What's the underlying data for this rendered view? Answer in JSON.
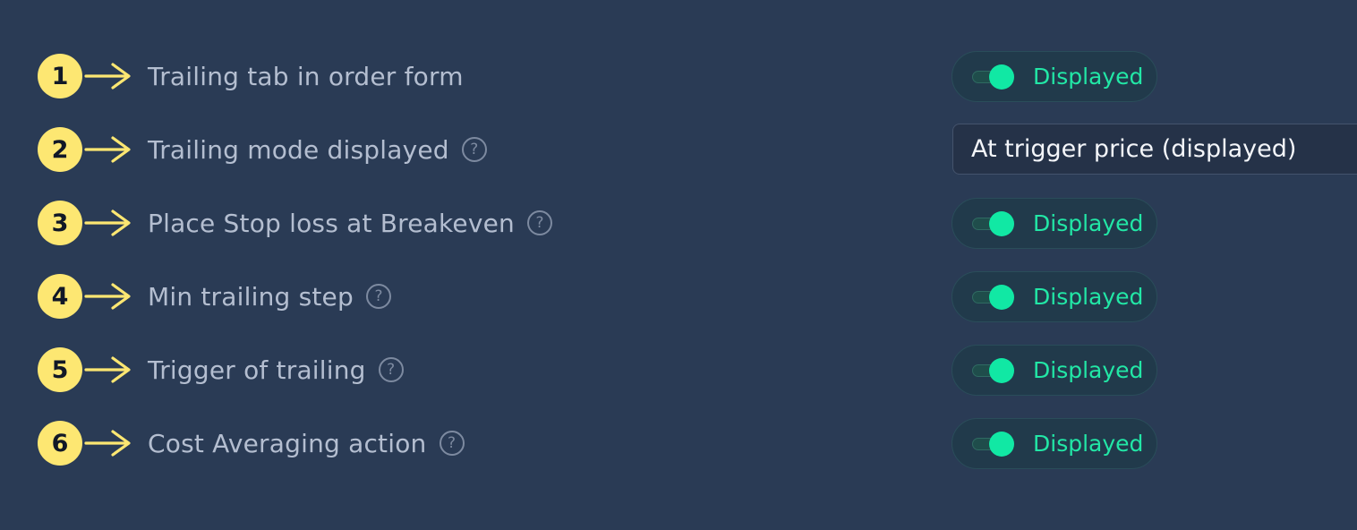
{
  "settings": [
    {
      "number": "1",
      "label": "Trailing tab in order form",
      "has_help": false,
      "control": "toggle",
      "value": "Displayed",
      "on": true
    },
    {
      "number": "2",
      "label": "Trailing mode displayed",
      "has_help": true,
      "control": "select",
      "value": "At trigger price (displayed)"
    },
    {
      "number": "3",
      "label": "Place Stop loss at Breakeven",
      "has_help": true,
      "control": "toggle",
      "value": "Displayed",
      "on": true
    },
    {
      "number": "4",
      "label": "Min trailing step",
      "has_help": true,
      "control": "toggle",
      "value": "Displayed",
      "on": true
    },
    {
      "number": "5",
      "label": "Trigger of trailing",
      "has_help": true,
      "control": "toggle",
      "value": "Displayed",
      "on": true
    },
    {
      "number": "6",
      "label": "Cost Averaging action",
      "has_help": true,
      "control": "toggle",
      "value": "Displayed",
      "on": true
    }
  ],
  "help_glyph": "?",
  "icons": {
    "badge": "number-badge-icon",
    "arrow": "arrow-right-icon",
    "help": "question-circle-icon"
  },
  "colors": {
    "background": "#2a3b55",
    "badge": "#fde772",
    "arrow": "#fde772",
    "toggle_accent": "#11e8a4",
    "toggle_text": "#22e7a6",
    "label": "#b4bed0"
  }
}
